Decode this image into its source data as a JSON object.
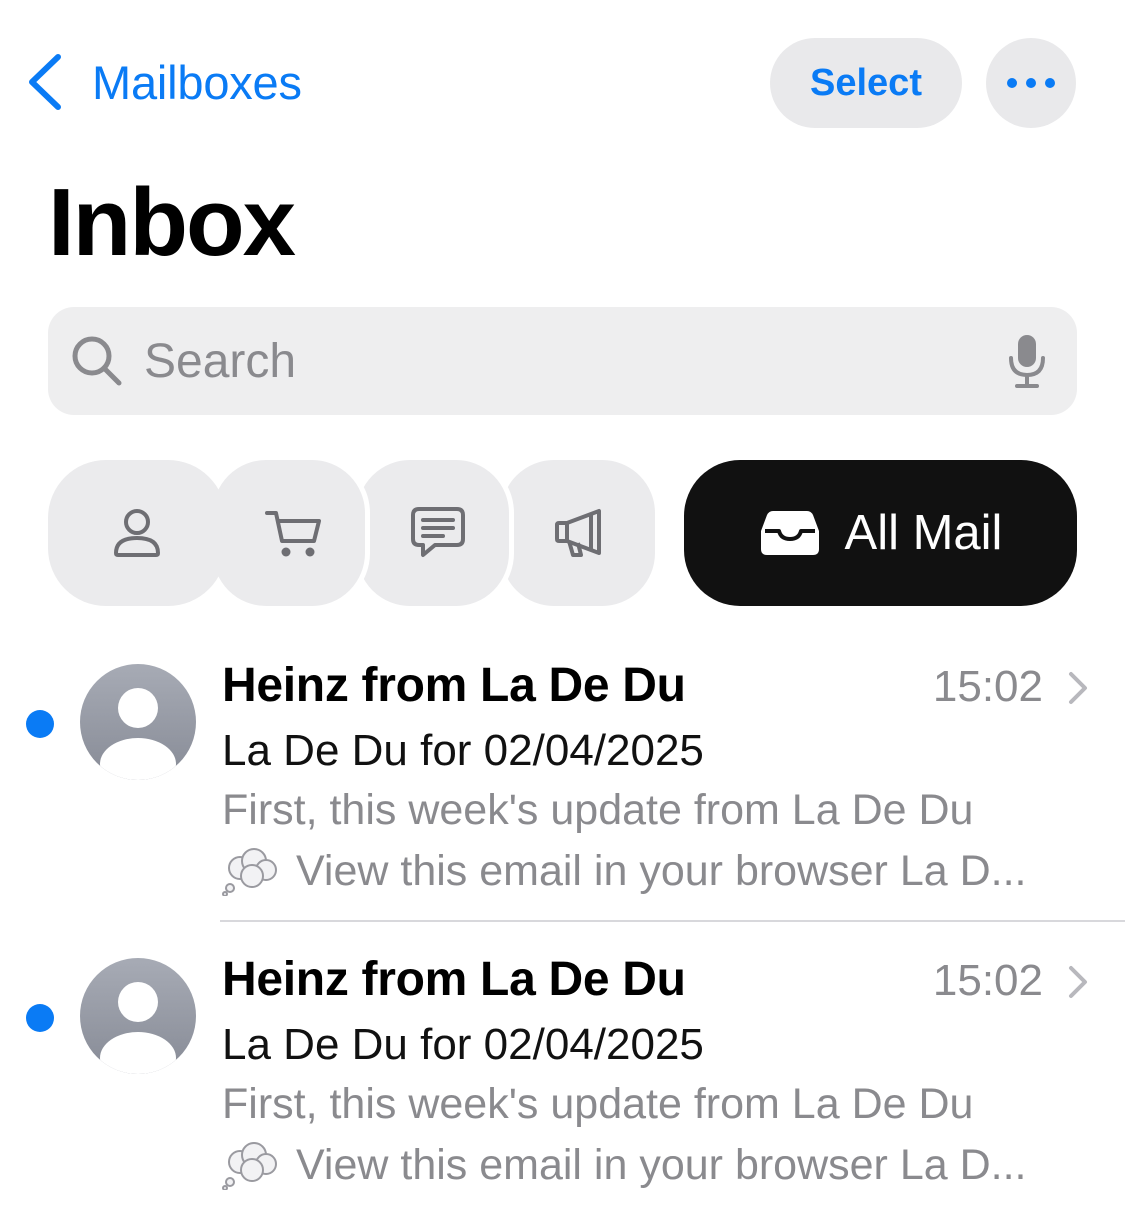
{
  "nav": {
    "back_label": "Mailboxes",
    "select_label": "Select",
    "more_icon": "ellipsis-icon"
  },
  "title": "Inbox",
  "search": {
    "placeholder": "Search"
  },
  "categories": [
    {
      "name": "Primary",
      "icon": "person-icon"
    },
    {
      "name": "Transactions",
      "icon": "cart-icon"
    },
    {
      "name": "Updates",
      "icon": "message-icon"
    },
    {
      "name": "Promotions",
      "icon": "megaphone-icon"
    }
  ],
  "all_mail_label": "All Mail",
  "emails": [
    {
      "sender": "Heinz from La De Du",
      "time": "15:02",
      "subject": "La De Du for 02/04/2025",
      "preview_line1": "First, this week's update from La De Du",
      "preview_line2": "View this email in your browser La D...",
      "unread": true
    },
    {
      "sender": "Heinz from La De Du",
      "time": "15:02",
      "subject": "La De Du for 02/04/2025",
      "preview_line1": "First, this week's update from La De Du",
      "preview_line2": "View this email in your browser La D...",
      "unread": true
    }
  ],
  "colors": {
    "accent": "#0a7bf5",
    "secondary_text": "#8a8a8e",
    "pill_bg": "#ebebed",
    "selected_pill_bg": "#111111"
  }
}
